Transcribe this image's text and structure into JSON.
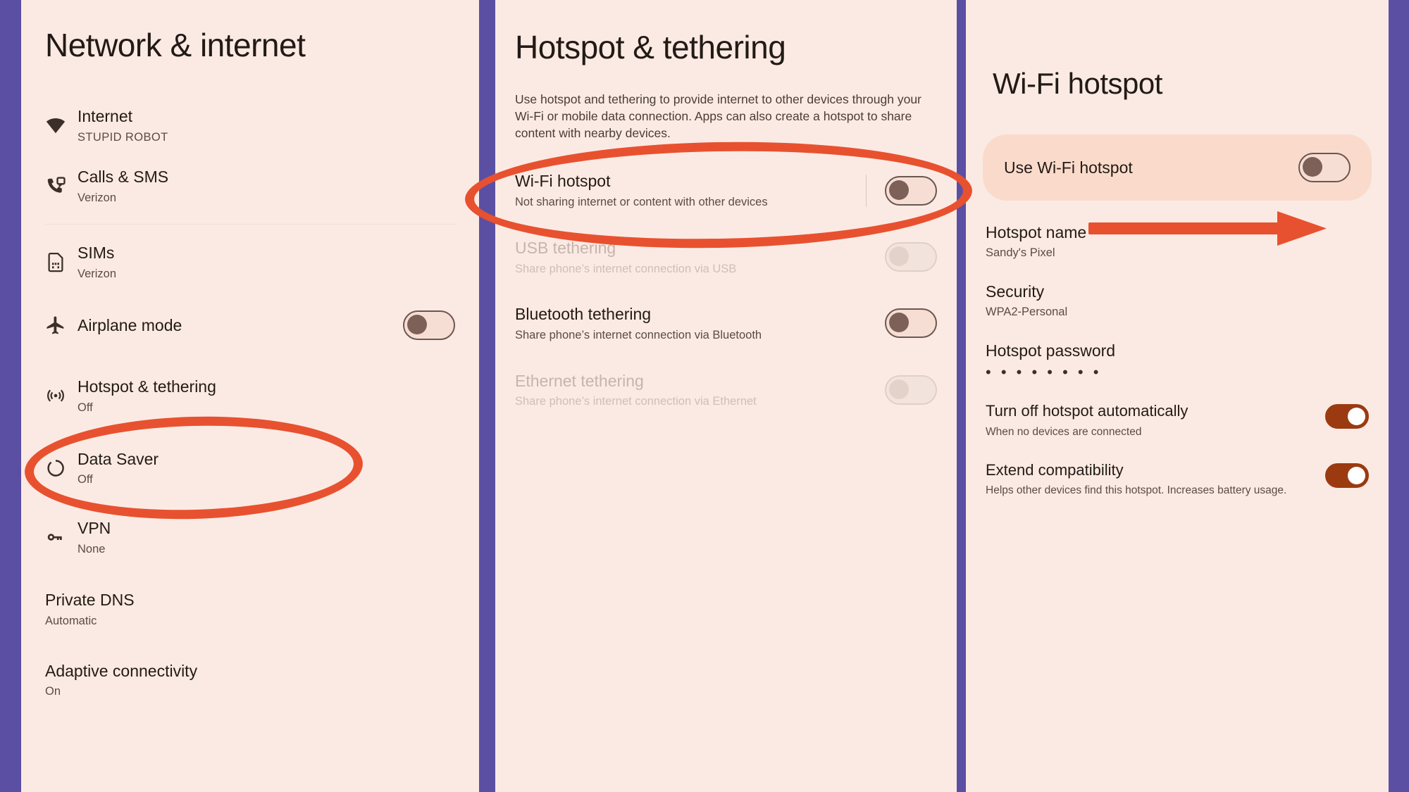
{
  "colors": {
    "background": "#5b4fa3",
    "panel": "#fbeae3",
    "accent_annotation": "#e8512f",
    "toggle_on": "#9b3a10",
    "hero_card": "#fadbcb"
  },
  "left_panel": {
    "title": "Network & internet",
    "items": [
      {
        "icon": "wifi-icon",
        "title": "Internet",
        "subtitle": "STUPID ROBOT"
      },
      {
        "icon": "calls-sms-icon",
        "title": "Calls & SMS",
        "subtitle": "Verizon"
      },
      {
        "icon": "sim-card-icon",
        "title": "SIMs",
        "subtitle": "Verizon"
      },
      {
        "icon": "airplane-icon",
        "title": "Airplane mode",
        "subtitle": ""
      },
      {
        "icon": "hotspot-icon",
        "title": "Hotspot & tethering",
        "subtitle": "Off"
      },
      {
        "icon": "data-saver-icon",
        "title": "Data Saver",
        "subtitle": "Off"
      },
      {
        "icon": "vpn-key-icon",
        "title": "VPN",
        "subtitle": "None"
      },
      {
        "icon": "",
        "title": "Private DNS",
        "subtitle": "Automatic"
      },
      {
        "icon": "",
        "title": "Adaptive connectivity",
        "subtitle": "On"
      }
    ]
  },
  "middle_panel": {
    "title": "Hotspot & tethering",
    "description": "Use hotspot and tethering to provide internet to other devices through your Wi-Fi or mobile data connection. Apps can also create a hotspot to share content with nearby devices.",
    "items": [
      {
        "title": "Wi-Fi hotspot",
        "subtitle": "Not sharing internet or content with other devices",
        "toggle_state": "off",
        "enabled": true
      },
      {
        "title": "USB tethering",
        "subtitle": "Share phone’s internet connection via USB",
        "toggle_state": "off",
        "enabled": false
      },
      {
        "title": "Bluetooth tethering",
        "subtitle": "Share phone’s internet connection via Bluetooth",
        "toggle_state": "off",
        "enabled": true
      },
      {
        "title": "Ethernet tethering",
        "subtitle": "Share phone’s internet connection via Ethernet",
        "toggle_state": "off",
        "enabled": false
      }
    ]
  },
  "right_panel": {
    "title": "Wi-Fi hotspot",
    "hero": {
      "label": "Use Wi-Fi hotspot",
      "toggle_state": "off"
    },
    "details": [
      {
        "title": "Hotspot name",
        "value": "Sandy's Pixel"
      },
      {
        "title": "Security",
        "value": "WPA2-Personal"
      },
      {
        "title": "Hotspot password",
        "value": "• • • • • • • •",
        "masked": true
      }
    ],
    "switch_rows": [
      {
        "title": "Turn off hotspot automatically",
        "subtitle": "When no devices are connected",
        "toggle_state": "on"
      },
      {
        "title": "Extend compatibility",
        "subtitle": "Helps other devices find this hotspot. Increases battery usage.",
        "toggle_state": "on"
      }
    ]
  }
}
